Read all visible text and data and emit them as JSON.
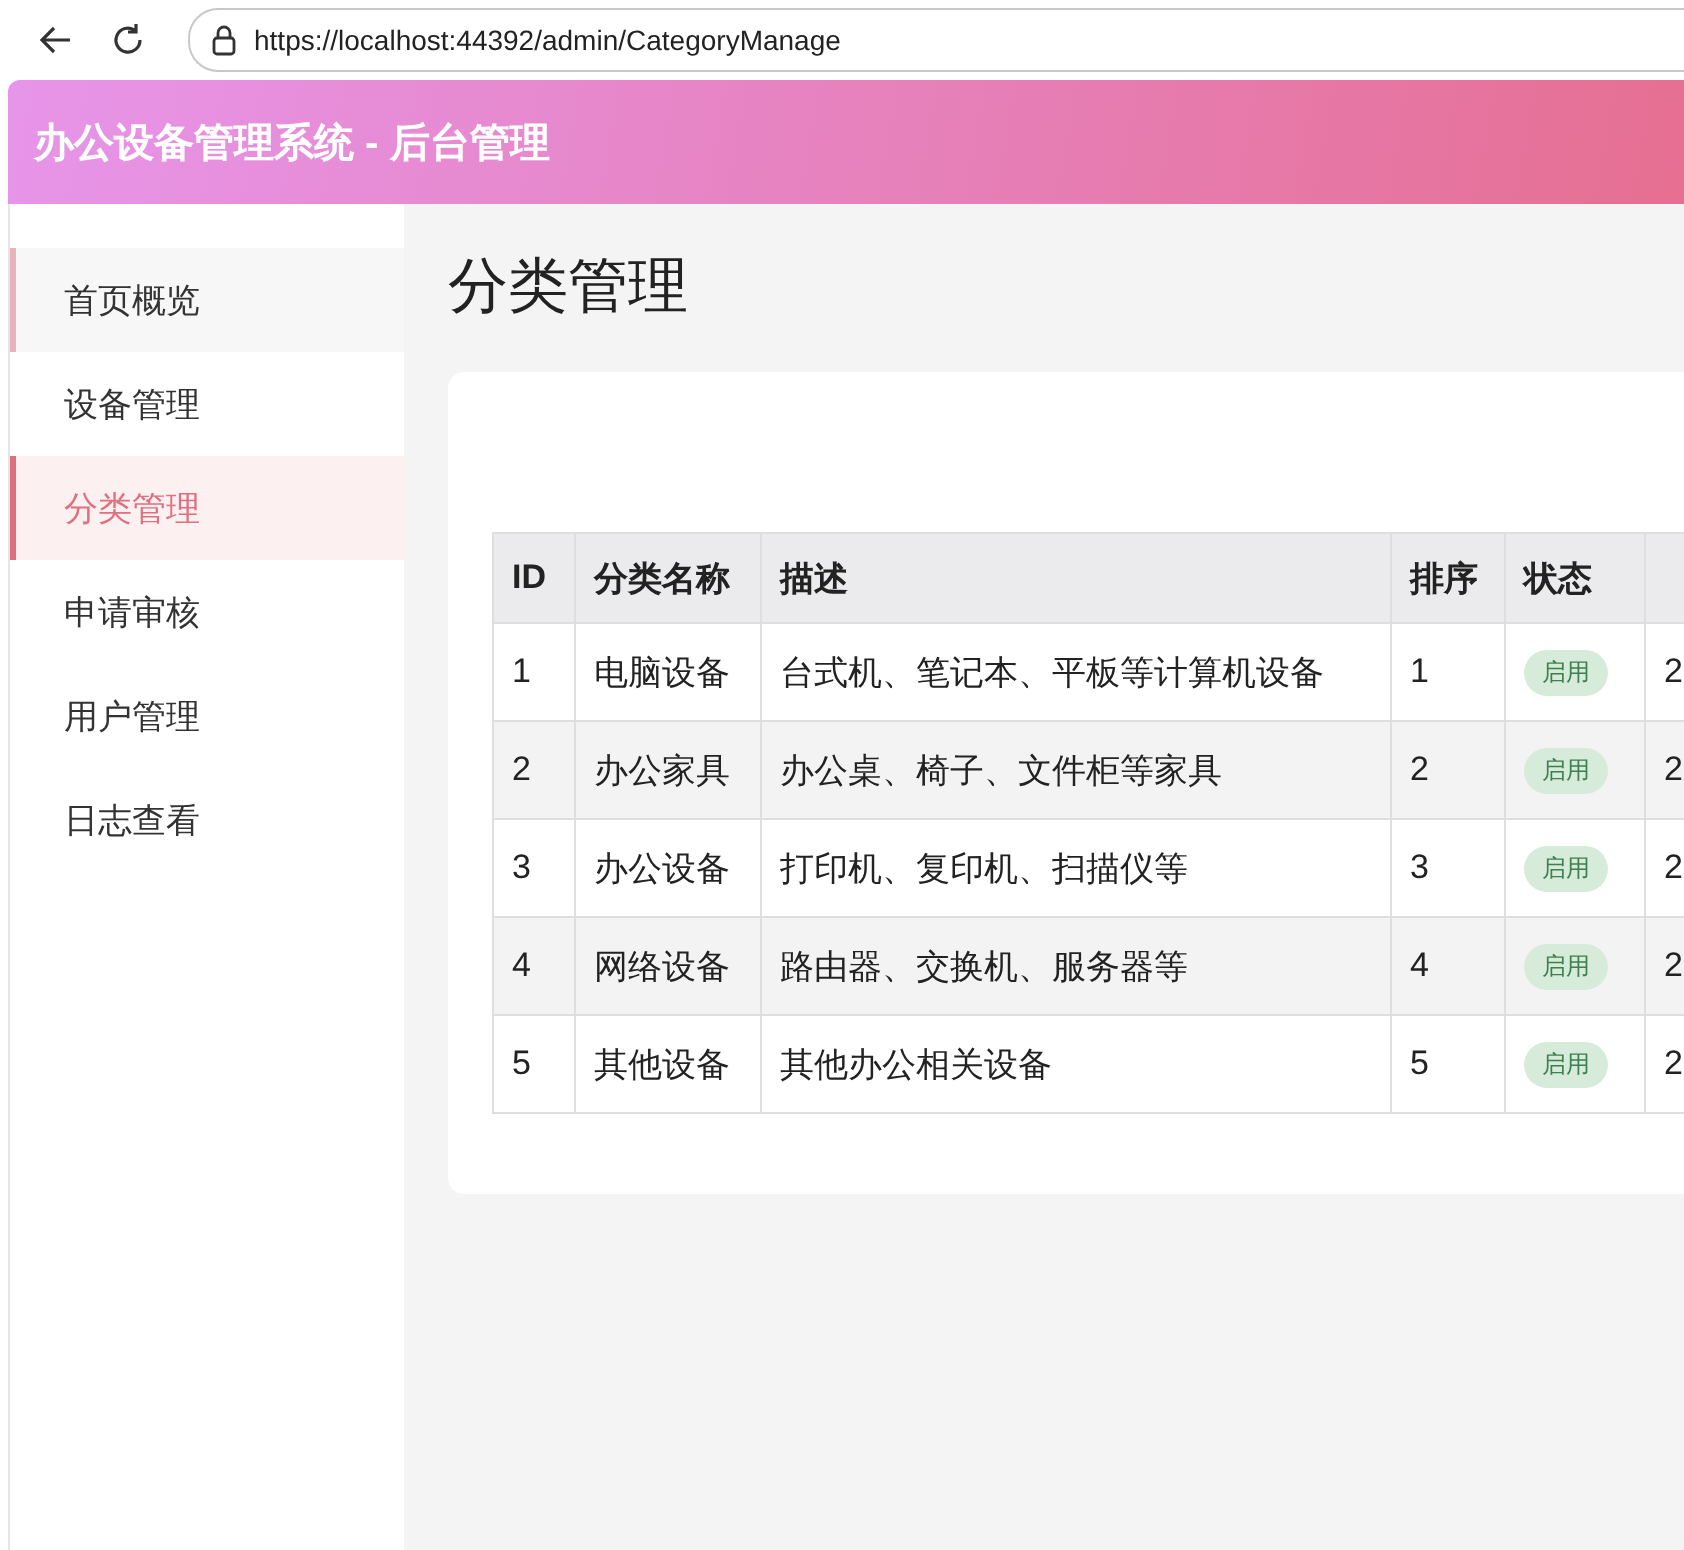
{
  "browser": {
    "url": "https://localhost:44392/admin/CategoryManage"
  },
  "header": {
    "title": "办公设备管理系统 - 后台管理"
  },
  "sidebar": {
    "items": [
      {
        "label": "首页概览",
        "selected": false,
        "hovered": true
      },
      {
        "label": "设备管理",
        "selected": false,
        "hovered": false
      },
      {
        "label": "分类管理",
        "selected": true,
        "hovered": false
      },
      {
        "label": "申请审核",
        "selected": false,
        "hovered": false
      },
      {
        "label": "用户管理",
        "selected": false,
        "hovered": false
      },
      {
        "label": "日志查看",
        "selected": false,
        "hovered": false
      }
    ]
  },
  "page": {
    "title": "分类管理"
  },
  "table": {
    "columns": [
      "ID",
      "分类名称",
      "描述",
      "排序",
      "状态"
    ],
    "rows": [
      {
        "id": "1",
        "name": "电脑设备",
        "description": "台式机、笔记本、平板等计算机设备",
        "sort": "1",
        "status": "启用",
        "column_6": "2"
      },
      {
        "id": "2",
        "name": "办公家具",
        "description": "办公桌、椅子、文件柜等家具",
        "sort": "2",
        "status": "启用",
        "column_6": "2"
      },
      {
        "id": "3",
        "name": "办公设备",
        "description": "打印机、复印机、扫描仪等",
        "sort": "3",
        "status": "启用",
        "column_6": "2"
      },
      {
        "id": "4",
        "name": "网络设备",
        "description": "路由器、交换机、服务器等",
        "sort": "4",
        "status": "启用",
        "column_6": "2"
      },
      {
        "id": "5",
        "name": "其他设备",
        "description": "其他办公相关设备",
        "sort": "5",
        "status": "启用",
        "column_6": "2"
      }
    ]
  }
}
